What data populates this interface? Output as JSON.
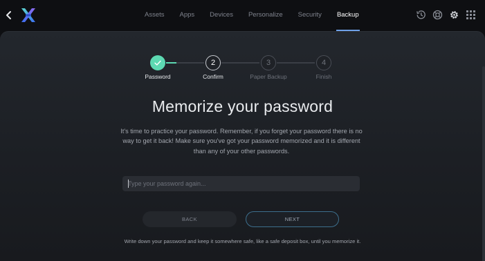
{
  "nav": {
    "tabs": [
      {
        "label": "Assets",
        "active": false
      },
      {
        "label": "Apps",
        "active": false
      },
      {
        "label": "Devices",
        "active": false
      },
      {
        "label": "Personalize",
        "active": false
      },
      {
        "label": "Security",
        "active": false
      },
      {
        "label": "Backup",
        "active": true
      }
    ],
    "icons": [
      "history-icon",
      "support-icon",
      "settings-icon",
      "apps-grid-icon"
    ]
  },
  "stepper": {
    "steps": [
      {
        "number": "1",
        "label": "Password",
        "state": "done"
      },
      {
        "number": "2",
        "label": "Confirm",
        "state": "current"
      },
      {
        "number": "3",
        "label": "Paper Backup",
        "state": "pending"
      },
      {
        "number": "4",
        "label": "Finish",
        "state": "pending"
      }
    ]
  },
  "content": {
    "title": "Memorize your password",
    "description": "It's time to practice your password. Remember, if you forget your password there is no way to get it back! Make sure you've got your password memorized and it is different than any of your other passwords.",
    "password_placeholder": "Type your password again...",
    "password_value": "",
    "back_label": "BACK",
    "next_label": "NEXT",
    "footnote": "Write down your password and keep it somewhere safe, like a safe deposit box, until you memorize it."
  },
  "colors": {
    "accent_green": "#5dd9b2",
    "accent_blue": "#6fa1e8",
    "logo_blue": "#3b6ef0",
    "logo_purple": "#8e6bf0"
  }
}
